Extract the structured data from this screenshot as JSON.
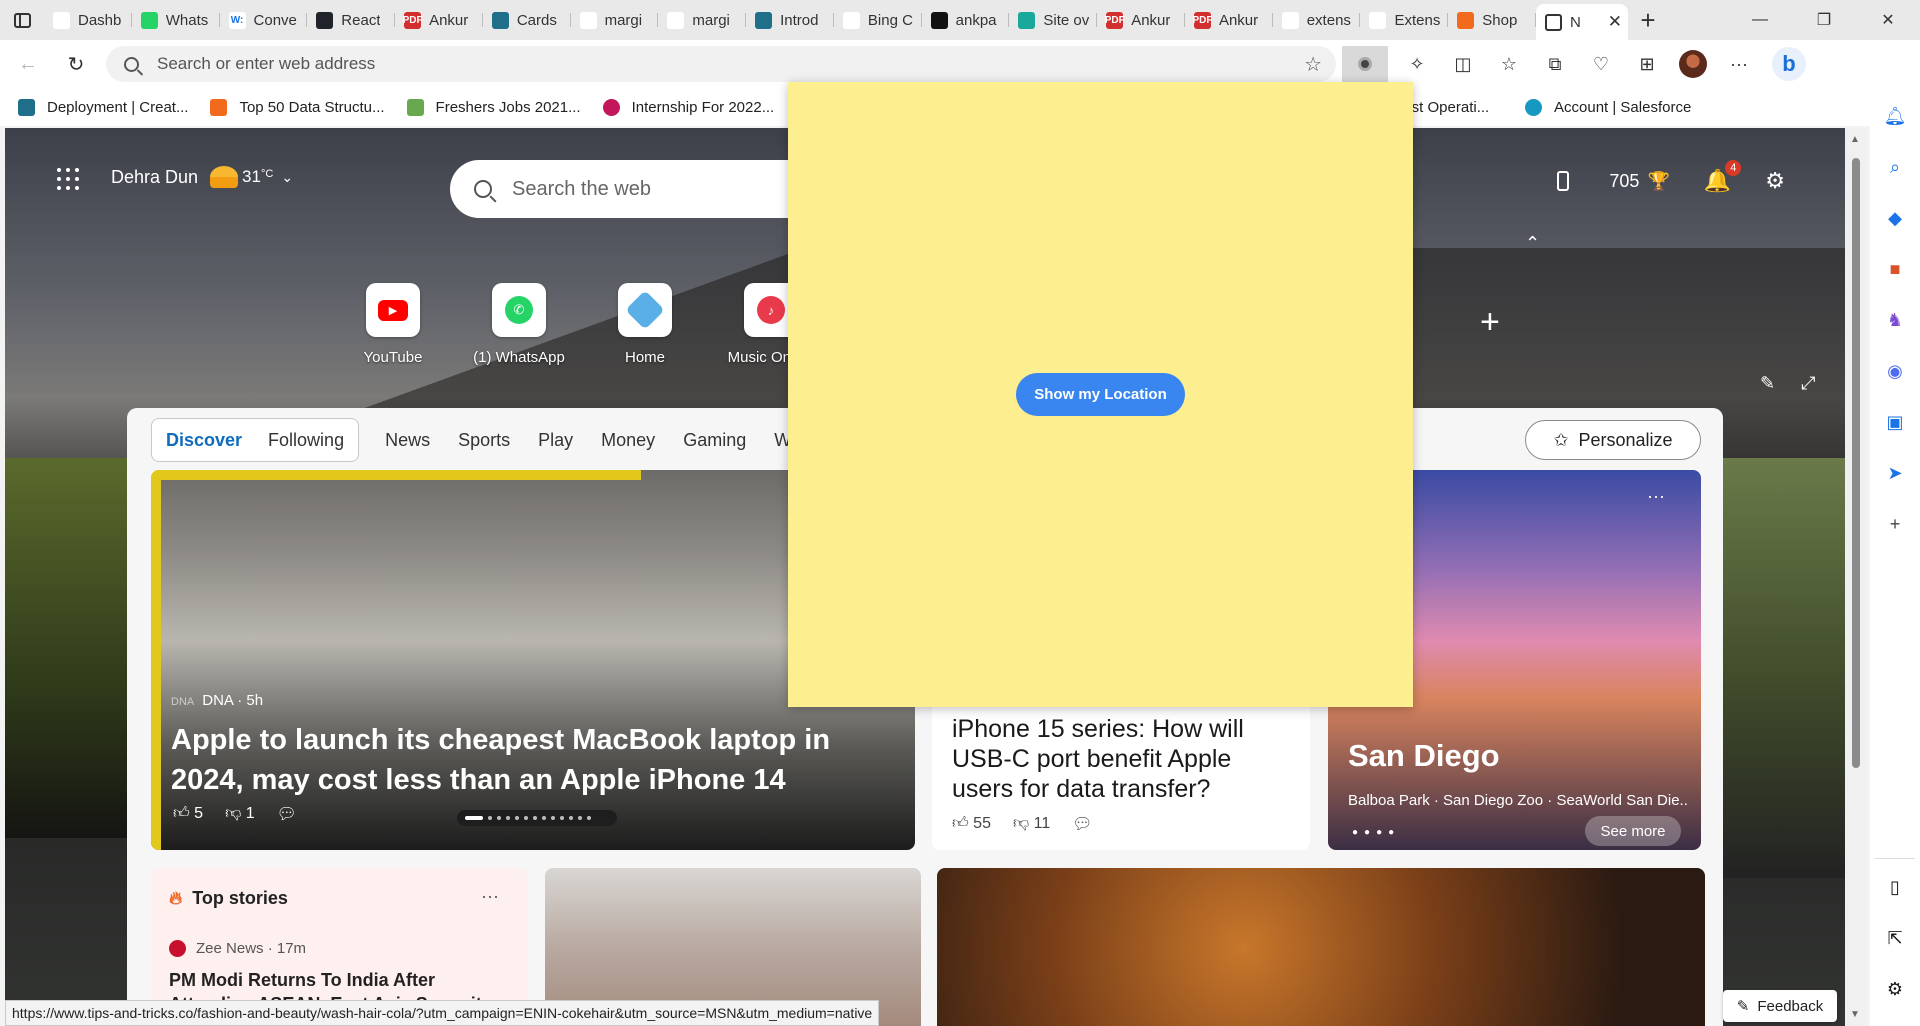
{
  "tabs": [
    {
      "title": "Dashb",
      "fav_color": "#ffffff",
      "fav_text": ""
    },
    {
      "title": "Whats",
      "fav_color": "#25d366",
      "fav_text": ""
    },
    {
      "title": "Conve",
      "fav_color": "#ffffff",
      "fav_text": "W:"
    },
    {
      "title": "React",
      "fav_color": "#20232a",
      "fav_text": ""
    },
    {
      "title": "Ankur",
      "fav_color": "#d32f2f",
      "fav_text": "PDF"
    },
    {
      "title": "Cards",
      "fav_color": "#1f6f8b",
      "fav_text": ""
    },
    {
      "title": "margi",
      "fav_color": "#ffffff",
      "fav_text": ""
    },
    {
      "title": "margi",
      "fav_color": "#ffffff",
      "fav_text": ""
    },
    {
      "title": "Introd",
      "fav_color": "#1f6f8b",
      "fav_text": ""
    },
    {
      "title": "Bing C",
      "fav_color": "#ffffff",
      "fav_text": ""
    },
    {
      "title": "ankpa",
      "fav_color": "#111111",
      "fav_text": ""
    },
    {
      "title": "Site ov",
      "fav_color": "#1aa89c",
      "fav_text": ""
    },
    {
      "title": "Ankur",
      "fav_color": "#d32f2f",
      "fav_text": "PDF"
    },
    {
      "title": "Ankur",
      "fav_color": "#d32f2f",
      "fav_text": "PDF"
    },
    {
      "title": "extens",
      "fav_color": "#ffffff",
      "fav_text": ""
    },
    {
      "title": "Extens",
      "fav_color": "#ffffff",
      "fav_text": ""
    },
    {
      "title": "Shop",
      "fav_color": "#f26b1d",
      "fav_text": ""
    }
  ],
  "active_tab": {
    "title": "N"
  },
  "toolbar": {
    "address_placeholder": "Search or enter web address"
  },
  "bookmarks": [
    {
      "label": "Deployment | Creat...",
      "color": "#1f6f8b"
    },
    {
      "label": "Top 50 Data Structu...",
      "color": "#f26b1d"
    },
    {
      "label": "Freshers Jobs 2021...",
      "color": "#6aa84f"
    },
    {
      "label": "Internship For 2022...",
      "color": "#c2185b"
    },
    {
      "label": "List Operati...",
      "color": "#9e9e9e"
    },
    {
      "label": "Account | Salesforce",
      "color": "#1798c1"
    }
  ],
  "ntp": {
    "location": "Dehra Dun",
    "temperature": "31",
    "temp_unit": "°C",
    "search_placeholder": "Search the web",
    "points": "705",
    "notifications": "4"
  },
  "quick_links": [
    {
      "label": "YouTube"
    },
    {
      "label": "(1) WhatsApp"
    },
    {
      "label": "Home"
    },
    {
      "label": "Music Online"
    }
  ],
  "feed_tabs": {
    "primary": [
      "Discover",
      "Following"
    ],
    "categories": [
      "News",
      "Sports",
      "Play",
      "Money",
      "Gaming",
      "We"
    ]
  },
  "personalize_label": "Personalize",
  "hero": {
    "source": "DNA · 5h",
    "source_logo": "DNA",
    "headline": "Apple to launch its cheapest MacBook laptop in 2024, may cost less than an Apple iPhone 14",
    "likes": "5",
    "dislikes": "1"
  },
  "mid_card": {
    "headline": "iPhone 15 series: How will USB-C port benefit Apple users for data transfer?",
    "likes": "55",
    "dislikes": "11"
  },
  "san_diego": {
    "title": "San Diego",
    "subtitle": "Balboa Park · San Diego Zoo · SeaWorld San Die...",
    "see_more": "See more"
  },
  "top_stories": {
    "title": "Top stories",
    "source": "Zee News · 17m",
    "headline": "PM Modi Returns To India After Attending ASEAN, East Asia Summits I..."
  },
  "status_url": "https://www.tips-and-tricks.co/fashion-and-beauty/wash-hair-cola/?utm_campaign=ENIN-cokehair&utm_source=MSN&utm_medium=native",
  "feedback_label": "Feedback",
  "popup": {
    "button_label": "Show my Location",
    "background": "#fdee8f",
    "button_color": "#3a86f0"
  }
}
